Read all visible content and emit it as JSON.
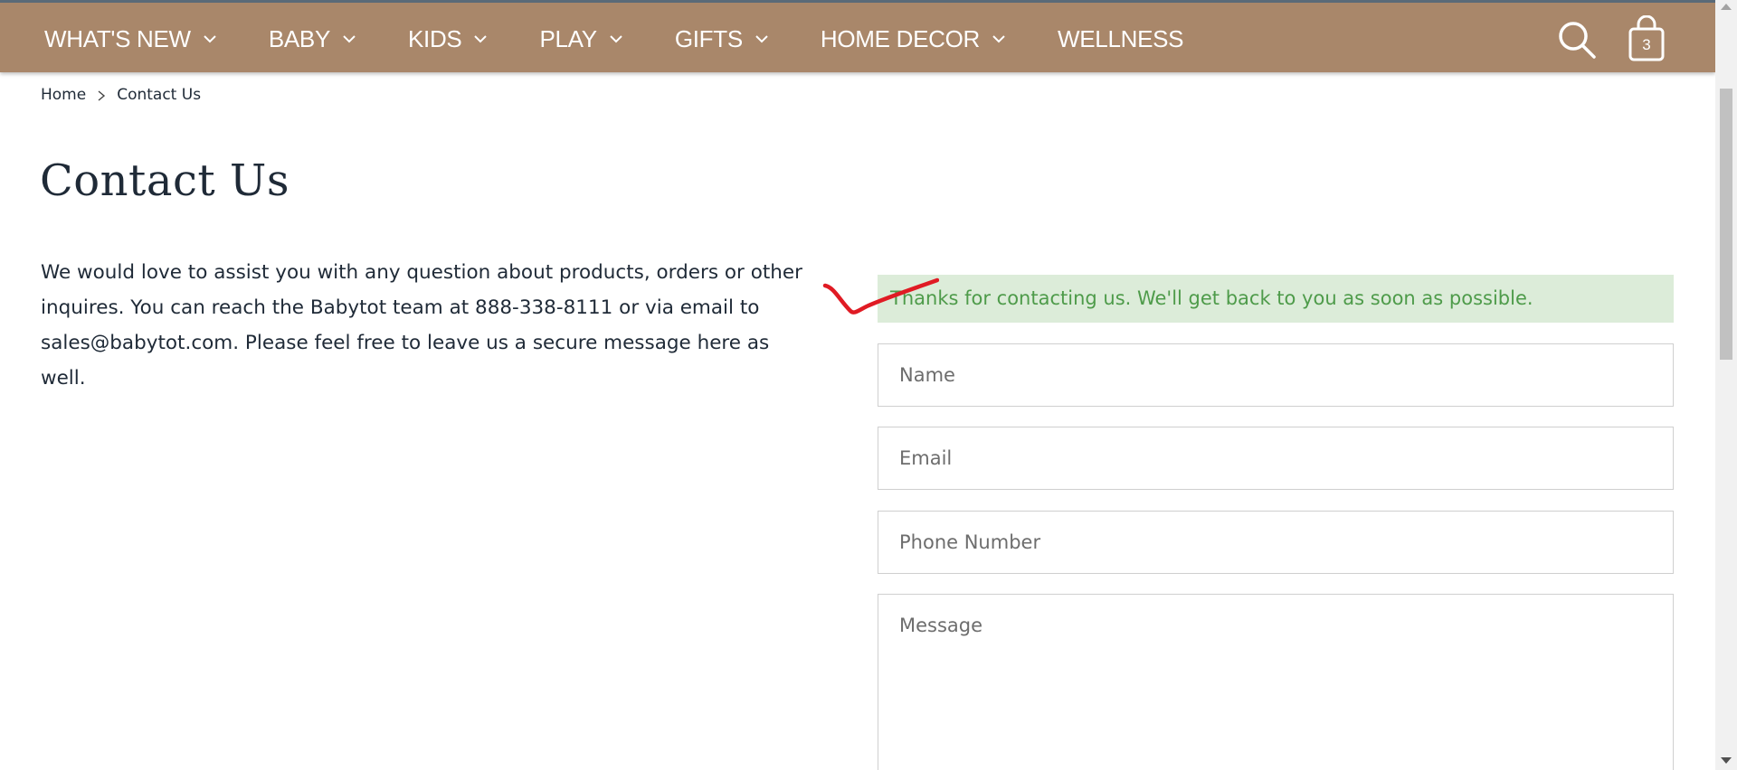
{
  "nav": {
    "items": [
      {
        "label": "WHAT'S NEW",
        "has_dropdown": true
      },
      {
        "label": "BABY",
        "has_dropdown": true
      },
      {
        "label": "KIDS",
        "has_dropdown": true
      },
      {
        "label": "PLAY",
        "has_dropdown": true
      },
      {
        "label": "GIFTS",
        "has_dropdown": true
      },
      {
        "label": "HOME DECOR",
        "has_dropdown": true
      },
      {
        "label": "WELLNESS",
        "has_dropdown": false
      }
    ],
    "search_icon": "search-icon",
    "cart_icon": "shopping-bag-icon",
    "cart_count": "3"
  },
  "breadcrumb": {
    "home": "Home",
    "current": "Contact Us"
  },
  "page": {
    "title": "Contact Us",
    "intro": "We would love to assist you with any question about products, orders or other inquires. You can reach the Babytot team at 888-338-8111 or via email to sales@babytot.com. Please feel free to leave us a secure message here as well."
  },
  "form": {
    "success_message": "Thanks for contacting us. We'll get back to you as soon as possible.",
    "name_placeholder": "Name",
    "email_placeholder": "Email",
    "phone_placeholder": "Phone Number",
    "message_placeholder": "Message"
  },
  "colors": {
    "header_bg": "#a9876a",
    "success_bg": "#dcecd9",
    "success_text": "#4e9b4a",
    "annotation": "#e01b24"
  }
}
